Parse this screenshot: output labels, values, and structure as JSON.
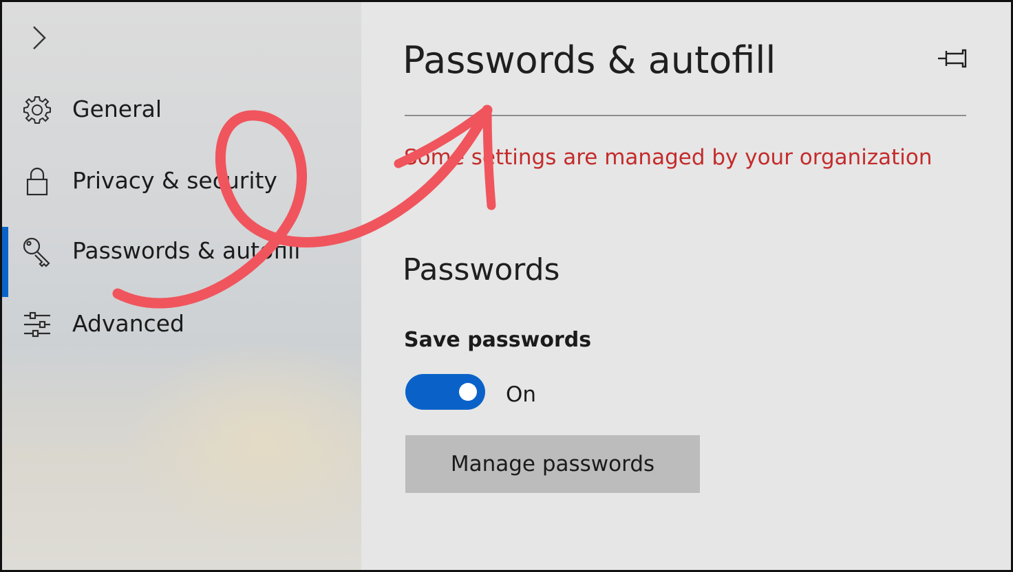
{
  "sidebar": {
    "expand_icon": "chevron-right-icon",
    "items": [
      {
        "label": "General",
        "icon": "gear-icon",
        "active": false
      },
      {
        "label": "Privacy & security",
        "icon": "lock-icon",
        "active": false
      },
      {
        "label": "Passwords & autofill",
        "icon": "key-icon",
        "active": true
      },
      {
        "label": "Advanced",
        "icon": "sliders-icon",
        "active": false
      }
    ],
    "active_color": "#0a64c8"
  },
  "header": {
    "title": "Passwords & autofill",
    "pin_icon": "pin-icon"
  },
  "notice": {
    "text": "Some settings are managed by your organization",
    "color": "#c42b2b"
  },
  "passwords_section": {
    "heading": "Passwords",
    "save_passwords": {
      "label": "Save passwords",
      "toggle_state": "On",
      "enabled": true,
      "toggle_color": "#0a62c9"
    },
    "manage_button_label": "Manage passwords"
  },
  "annotation": {
    "type": "hand-drawn-loop-arrow",
    "color": "#f0555d"
  }
}
